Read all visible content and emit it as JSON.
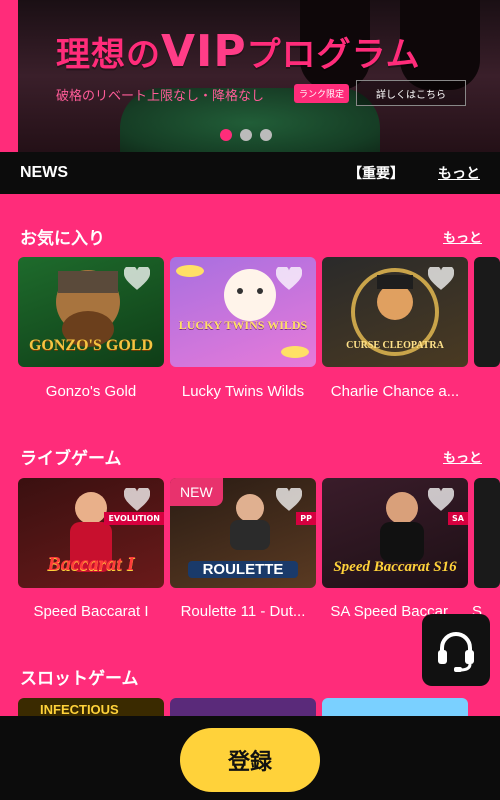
{
  "banner": {
    "title_prefix": "理想の",
    "title_vip": "VIP",
    "title_suffix": "プログラム",
    "subtitle": "破格のリベート上限なし・降格なし",
    "badge": "ランク限定",
    "details_button": "詳しくはこちら",
    "slide_count": 3,
    "active_slide": 1
  },
  "news": {
    "label": "NEWS",
    "important": "【重要】",
    "more": "もっと"
  },
  "favorites": {
    "title": "お気に入り",
    "more": "もっと",
    "games": [
      {
        "name": "Gonzo's Gold",
        "art_text": "GONZO'S GOLD"
      },
      {
        "name": "Lucky Twins Wilds",
        "art_text": "LUCKY TWINS WILDS"
      },
      {
        "name": "Charlie Chance a...",
        "art_text": "CURSE CLEOPATRA"
      }
    ]
  },
  "live": {
    "title": "ライブゲーム",
    "more": "もっと",
    "games": [
      {
        "name": "Speed Baccarat I",
        "art_text": "Baccarat I",
        "tag": "EVOLUTION"
      },
      {
        "name": "Roulette 11 - Dut...",
        "art_text": "ROULETTE",
        "tag": "PP",
        "badge": "NEW"
      },
      {
        "name": "SA Speed Baccar...",
        "art_text": "Speed Baccarat S16",
        "tag": "SA"
      }
    ],
    "partial_next": "S"
  },
  "slots": {
    "title": "スロットゲーム",
    "first_art_text": "INFECTIOUS"
  },
  "footer": {
    "register": "登録"
  },
  "colors": {
    "brand_pink": "#ff2c7a",
    "dark": "#0c0c0c",
    "register_yellow": "#ffd23a"
  },
  "icons": [
    "heart-icon",
    "headset-icon"
  ]
}
